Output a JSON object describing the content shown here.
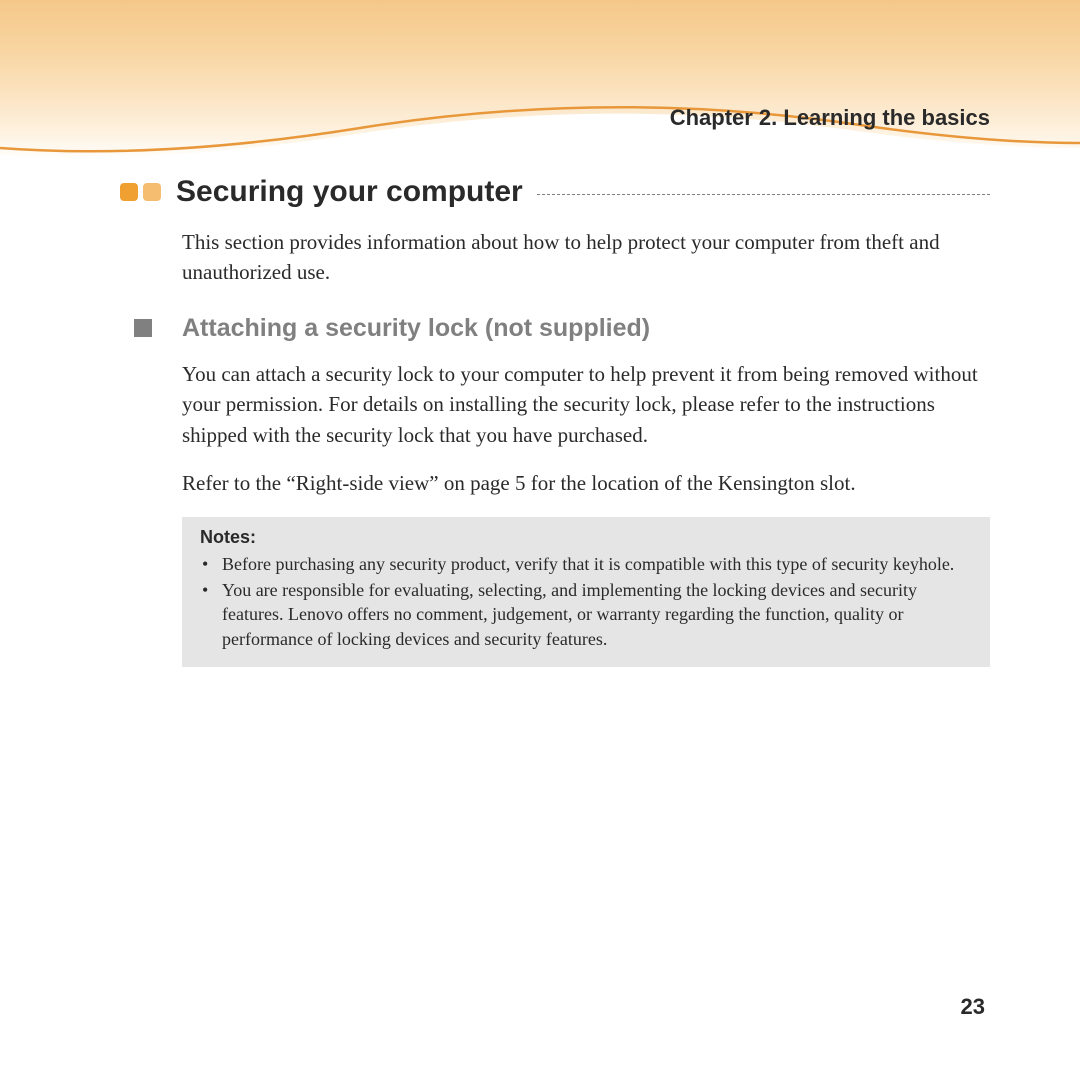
{
  "header": {
    "chapter": "Chapter 2. Learning the basics"
  },
  "section": {
    "title": "Securing your computer",
    "intro": "This section provides information about how to help protect your computer from theft and unauthorized use."
  },
  "subsection": {
    "title": "Attaching a security lock (not supplied)",
    "para1": "You can attach a security lock to your computer to help prevent it from being removed without your permission. For details on installing the security lock, please refer to the instructions shipped with the security lock that you have purchased.",
    "para2": "Refer to the “Right-side view” on page 5 for the location of the Kensington slot."
  },
  "notes": {
    "label": "Notes:",
    "items": [
      "Before purchasing any security product, verify that it is compatible with this type of security keyhole.",
      "You are responsible for evaluating, selecting, and implementing the locking devices and security features. Lenovo offers no comment, judgement, or warranty regarding the function, quality or performance of locking devices and security features."
    ]
  },
  "page_number": "23"
}
